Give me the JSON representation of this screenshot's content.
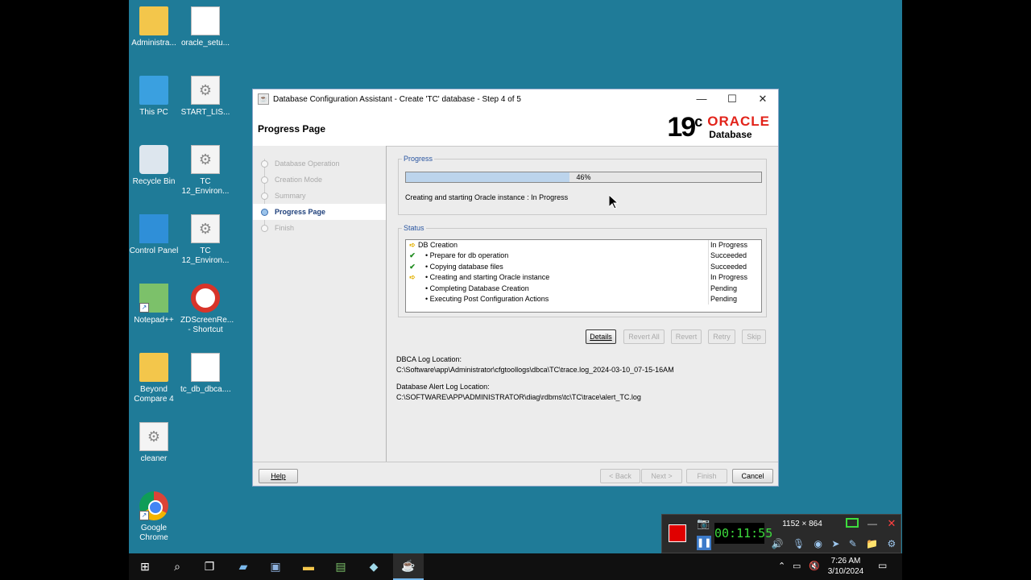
{
  "desktop": {
    "icons": [
      {
        "label": "Administra...",
        "icon": "user-folder-icon"
      },
      {
        "label": "oracle_setu...",
        "icon": "file-icon"
      },
      {
        "label": "This PC",
        "icon": "computer-icon"
      },
      {
        "label": "START_LIS...",
        "icon": "gear-file-icon"
      },
      {
        "label": "Recycle Bin",
        "icon": "recycle-bin-icon"
      },
      {
        "label": "TC 12_Environ...",
        "icon": "gear-file-icon"
      },
      {
        "label": "Control Panel",
        "icon": "control-panel-icon"
      },
      {
        "label": "TC 12_Environ...",
        "icon": "gear-file-icon"
      },
      {
        "label": "Notepad++",
        "icon": "notepad-plus-plus-icon"
      },
      {
        "label": "ZDScreenRe... - Shortcut",
        "icon": "zdscreen-recorder-icon"
      },
      {
        "label": "Beyond Compare 4",
        "icon": "folder-icon"
      },
      {
        "label": "tc_db_dbca....",
        "icon": "file-icon"
      },
      {
        "label": "cleaner",
        "icon": "gear-file-icon"
      },
      {
        "label": "Google Chrome",
        "icon": "chrome-icon"
      }
    ]
  },
  "window": {
    "title": "Database Configuration Assistant - Create 'TC' database - Step 4 of 5",
    "page_title": "Progress Page",
    "logo_version": "19",
    "logo_version_sup": "c",
    "logo_brand": "ORACLE",
    "logo_product": "Database",
    "steps": [
      {
        "label": "Database Operation",
        "state": "done"
      },
      {
        "label": "Creation Mode",
        "state": "done"
      },
      {
        "label": "Summary",
        "state": "done"
      },
      {
        "label": "Progress Page",
        "state": "active"
      },
      {
        "label": "Finish",
        "state": "pending"
      }
    ],
    "progress": {
      "group_label": "Progress",
      "percent": 46,
      "percent_text": "46%",
      "message": "Creating and starting Oracle instance : In Progress"
    },
    "status": {
      "group_label": "Status",
      "rows": [
        {
          "icon": "in-progress-arrow-icon",
          "name": "DB Creation",
          "status": "In Progress"
        },
        {
          "icon": "succeeded-check-icon",
          "name": "• Prepare for db operation",
          "status": "Succeeded"
        },
        {
          "icon": "succeeded-check-icon",
          "name": "• Copying database files",
          "status": "Succeeded"
        },
        {
          "icon": "in-progress-arrow-icon",
          "name": "• Creating and starting Oracle instance",
          "status": "In Progress"
        },
        {
          "icon": "",
          "name": "• Completing Database Creation",
          "status": "Pending"
        },
        {
          "icon": "",
          "name": "• Executing Post Configuration Actions",
          "status": "Pending"
        }
      ]
    },
    "action_buttons": {
      "details": "Details",
      "revert_all": "Revert All",
      "revert": "Revert",
      "retry": "Retry",
      "skip": "Skip"
    },
    "logs": {
      "dbca_label": "DBCA Log Location:",
      "dbca_path": "C:\\Software\\app\\Administrator\\cfgtoollogs\\dbca\\TC\\trace.log_2024-03-10_07-15-16AM",
      "alert_label": "Database Alert Log Location:",
      "alert_path": "C:\\SOFTWARE\\APP\\ADMINISTRATOR\\diag\\rdbms\\tc\\TC\\trace\\alert_TC.log"
    },
    "footer_buttons": {
      "help": "Help",
      "back": "< Back",
      "next": "Next >",
      "finish": "Finish",
      "cancel": "Cancel"
    }
  },
  "recorder": {
    "timer": "00:11:55",
    "resolution": "1152 × 864"
  },
  "taskbar": {
    "time": "7:26 AM",
    "date": "3/10/2024"
  },
  "colors": {
    "desktop_bg": "#1f7b98",
    "progress_fill": "#bcd4ec",
    "oracle_red": "#e2231a",
    "recorder_red": "#e00000"
  }
}
